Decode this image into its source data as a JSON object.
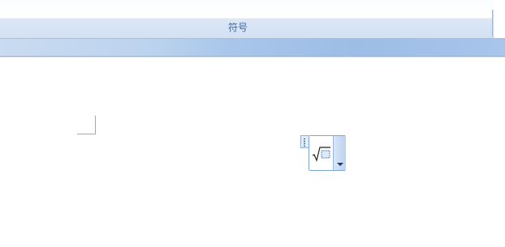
{
  "ribbon": {
    "group_caption": "符号"
  },
  "equation": {
    "icon": "square-root-placeholder-icon",
    "dropdown_icon": "chevron-down-icon",
    "handle_icon": "drag-handle-icon"
  },
  "colors": {
    "caption_text": "#3e6aaa",
    "ribbon_band": "#a9c6ea",
    "equation_border": "#7fa4d6"
  }
}
